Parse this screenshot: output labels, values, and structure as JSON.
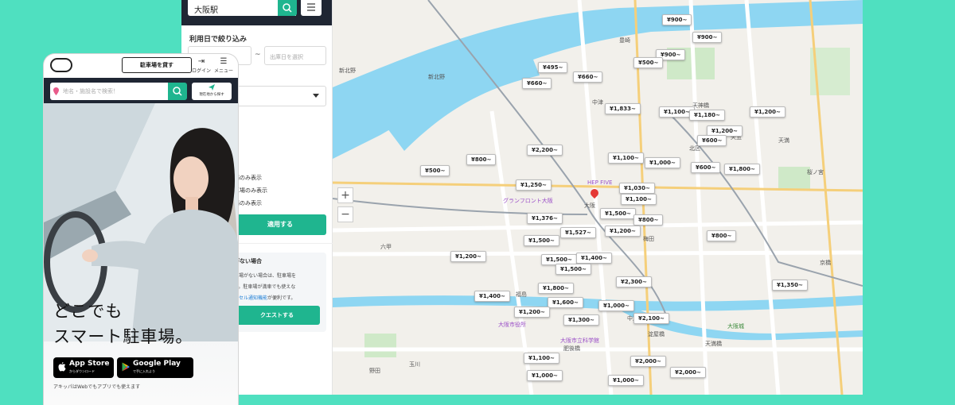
{
  "desktop": {
    "sidebar": {
      "search_value": "大阪駅",
      "filter_title": "利用日で絞り込み",
      "date_end_placeholder": "出庫日を選択",
      "date_sep": "~",
      "checks": [
        "場のみ表示",
        "車場のみ表示",
        "場のみ表示"
      ],
      "apply_label": "適用する",
      "info_title": "がない場合",
      "info_line1": "車場がない場合は、駐車場を",
      "info_line2": "す。駐車場が満車でも使えな",
      "info_link": "ンセル通知機能",
      "info_line3_suffix": "が便利です。",
      "request_label": "クエストする"
    },
    "map": {
      "zoom_in": "+",
      "zoom_out": "−",
      "price_pins": [
        "¥900~",
        "¥900~",
        "¥900~",
        "¥500~",
        "¥495~",
        "¥660~",
        "¥660~",
        "¥1,833~",
        "¥1,100~",
        "¥1,180~",
        "¥1,200~",
        "¥1,200~",
        "¥600~",
        "¥2,200~",
        "¥800~",
        "¥500~",
        "¥1,100~",
        "¥1,000~",
        "¥600~",
        "¥1,800~",
        "¥1,250~",
        "¥1,030~",
        "¥1,100~",
        "¥1,376~",
        "¥1,500~",
        "¥800~",
        "¥1,527~",
        "¥1,200~",
        "¥1,500~",
        "¥800~",
        "¥1,200~",
        "¥1,500~",
        "¥1,400~",
        "¥1,500~",
        "¥2,300~",
        "¥1,350~",
        "¥1,800~",
        "¥1,400~",
        "¥1,600~",
        "¥1,200~",
        "¥1,000~",
        "¥2,100~",
        "¥1,300~",
        "¥1,100~",
        "¥2,000~",
        "¥2,000~",
        "¥1,000~",
        "¥1,000~"
      ],
      "places": [
        "新北野",
        "新北野",
        "中津",
        "豊崎",
        "天神橋",
        "天五",
        "北区",
        "天満",
        "HEP FIVE",
        "グランフロント大阪",
        "大阪",
        "梅田",
        "福島",
        "中之島",
        "大阪市役所",
        "大阪市立科学館",
        "肥後橋",
        "淀屋橋",
        "天満橋",
        "大阪城",
        "六甲",
        "野田",
        "玉川",
        "桜ノ宮",
        "京橋"
      ]
    }
  },
  "mobile": {
    "top_button": "駐車場を貸す",
    "login_label": "ログイン",
    "menu_label": "メニュー",
    "search_placeholder": "地名・施設名で検索！",
    "location_label": "現在地から探す",
    "headline_line1": "どこでも",
    "headline_line2": "スマート駐車場。",
    "appstore_main": "App Store",
    "appstore_sub": "からダウンロード",
    "googleplay_main": "Google Play",
    "googleplay_sub": "で手に入れよう",
    "footnote": "アキッパはWebでもアプリでも使えます"
  },
  "colors": {
    "background": "#4fe0c0",
    "accent": "#1fb58f",
    "header_dark": "#1f2633",
    "river": "#7fd4f0",
    "marker_red": "#e53935"
  }
}
